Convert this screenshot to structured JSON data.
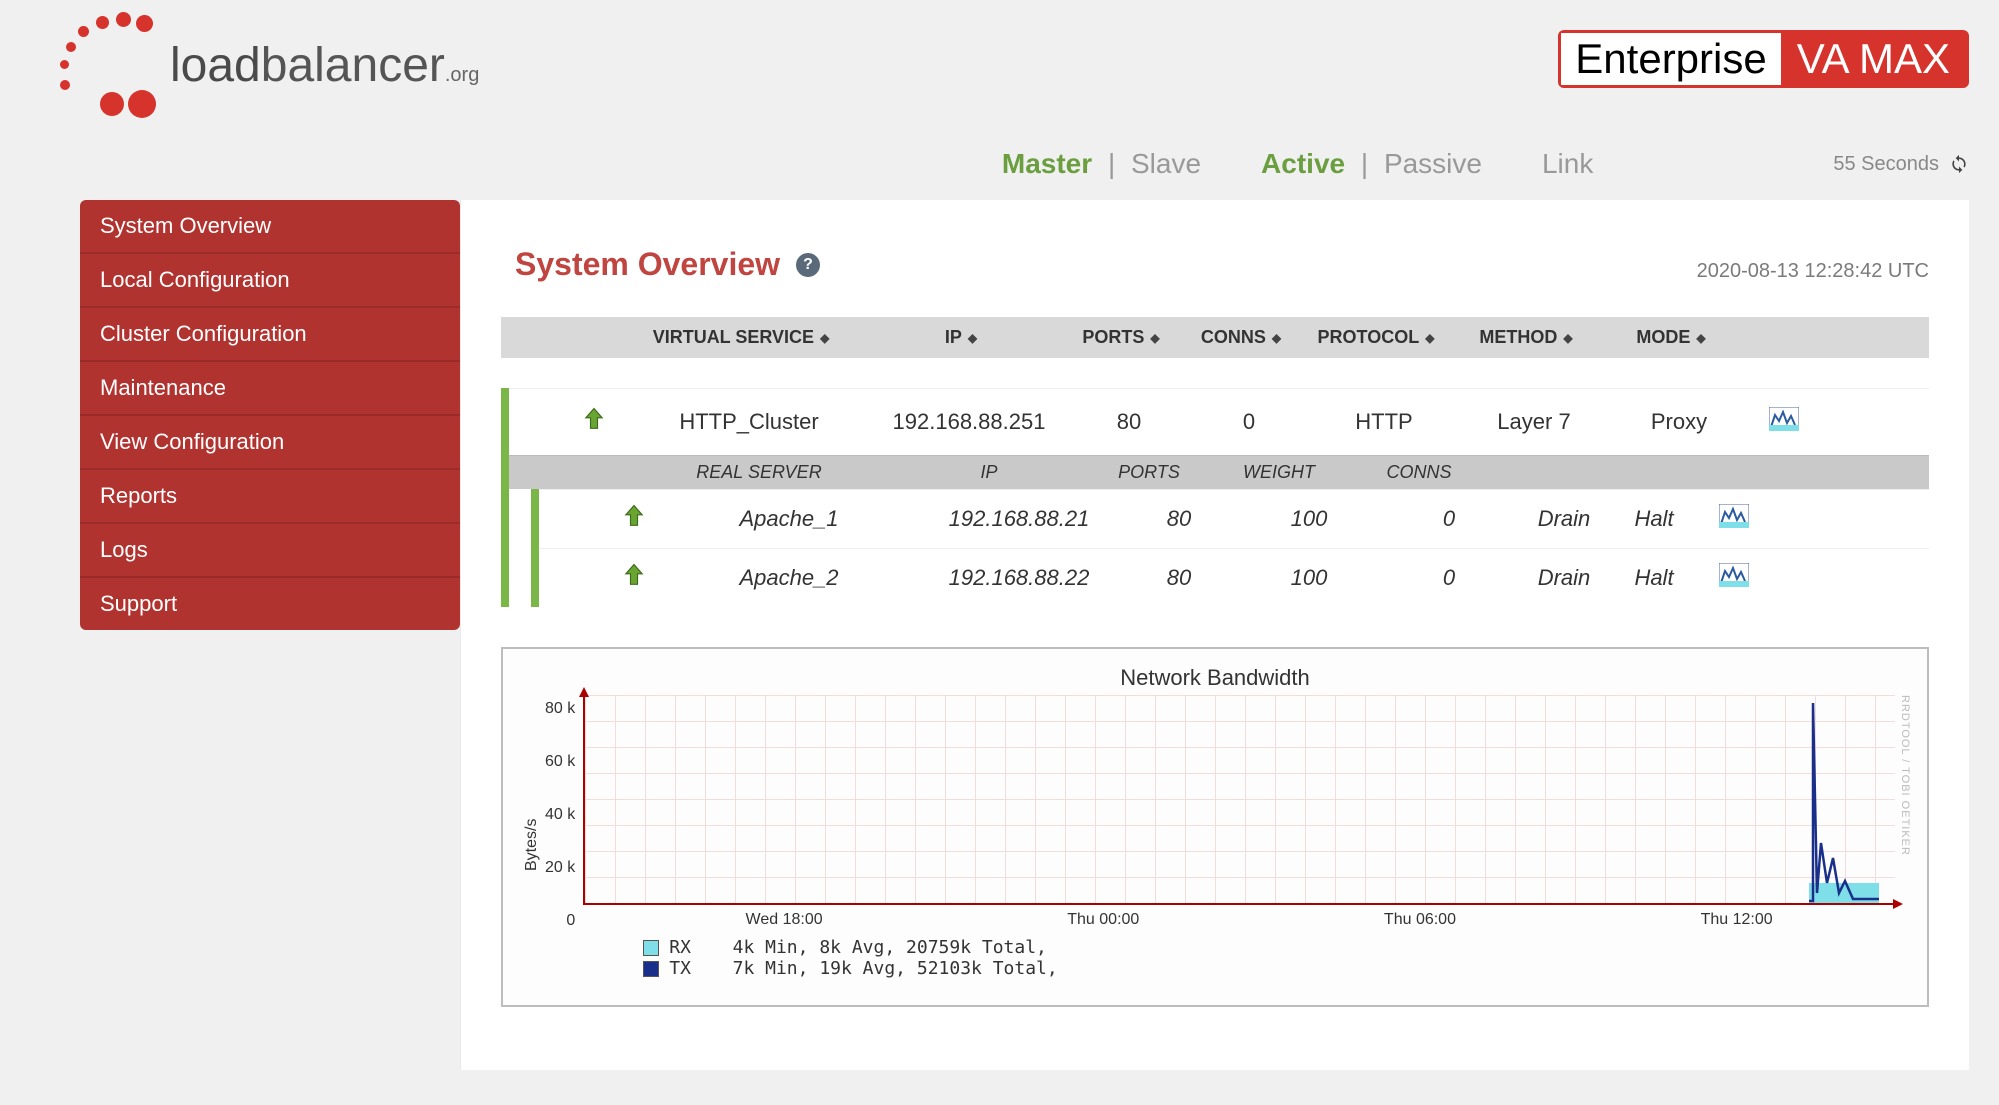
{
  "logo": {
    "text_bold": "load",
    "text_light": "balancer",
    "suffix": ".org"
  },
  "product": {
    "left": "Enterprise",
    "right": "VA MAX"
  },
  "status": {
    "master": "Master",
    "slave": "Slave",
    "active": "Active",
    "passive": "Passive",
    "link": "Link",
    "countdown": "55 Seconds"
  },
  "sidebar": {
    "items": [
      "System Overview",
      "Local Configuration",
      "Cluster Configuration",
      "Maintenance",
      "View Configuration",
      "Reports",
      "Logs",
      "Support"
    ]
  },
  "page": {
    "title": "System Overview",
    "timestamp": "2020-08-13 12:28:42 UTC"
  },
  "vs_headers": {
    "virtual_service": "VIRTUAL SERVICE",
    "ip": "IP",
    "ports": "PORTS",
    "conns": "CONNS",
    "protocol": "PROTOCOL",
    "method": "METHOD",
    "mode": "MODE"
  },
  "rs_headers": {
    "real_server": "REAL SERVER",
    "ip": "IP",
    "ports": "PORTS",
    "weight": "WEIGHT",
    "conns": "CONNS"
  },
  "vs": {
    "name": "HTTP_Cluster",
    "ip": "192.168.88.251",
    "ports": "80",
    "conns": "0",
    "protocol": "HTTP",
    "method": "Layer 7",
    "mode": "Proxy"
  },
  "rs": [
    {
      "name": "Apache_1",
      "ip": "192.168.88.21",
      "ports": "80",
      "weight": "100",
      "conns": "0",
      "a1": "Drain",
      "a2": "Halt"
    },
    {
      "name": "Apache_2",
      "ip": "192.168.88.22",
      "ports": "80",
      "weight": "100",
      "conns": "0",
      "a1": "Drain",
      "a2": "Halt"
    }
  ],
  "chart_data": {
    "type": "line",
    "title": "Network Bandwidth",
    "ylabel": "Bytes/s",
    "ylim": [
      0,
      80000
    ],
    "y_ticks": [
      "80 k",
      "60 k",
      "40 k",
      "20 k",
      "0"
    ],
    "x_ticks": [
      "Wed 18:00",
      "Thu 00:00",
      "Thu 06:00",
      "Thu 12:00"
    ],
    "series": [
      {
        "name": "RX",
        "color": "#7fdfe8",
        "summary": "4k Min,   8k Avg,  20759k Total,"
      },
      {
        "name": "TX",
        "color": "#1a2f8a",
        "summary": "7k Min,  19k Avg,  52103k Total,"
      }
    ],
    "watermark": "RRDTOOL / TOBI OETIKER"
  }
}
